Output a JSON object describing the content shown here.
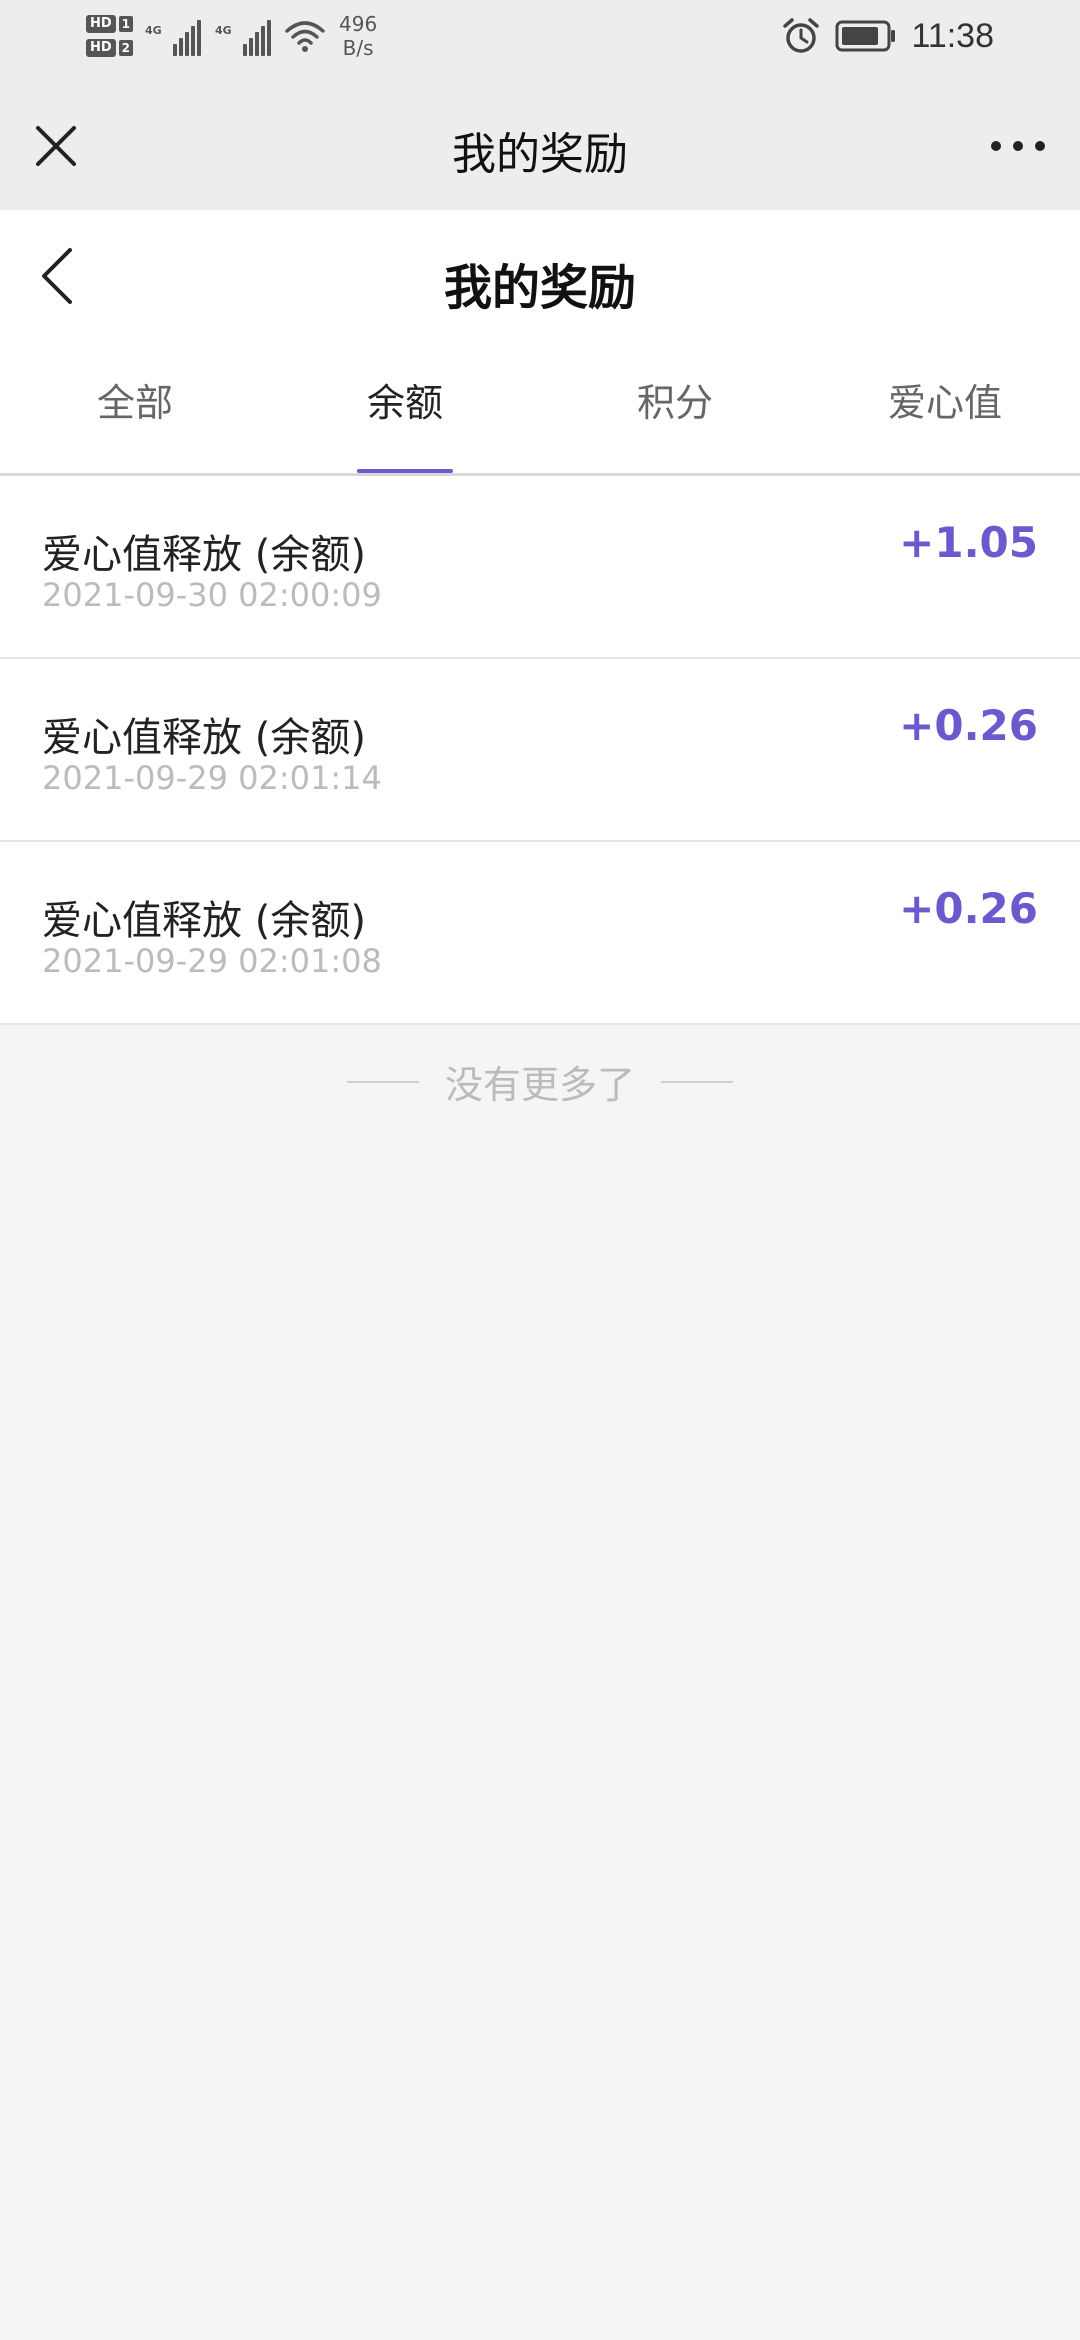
{
  "status_bar": {
    "hd1": "HD",
    "hd1_sim": "1",
    "hd2": "HD",
    "hd2_sim": "2",
    "network1": "4G",
    "network2": "4G",
    "speed_value": "496",
    "speed_unit": "B/s",
    "time": "11:38"
  },
  "nav_bar": {
    "title": "我的奖励"
  },
  "page": {
    "title": "我的奖励"
  },
  "tabs": [
    {
      "label": "全部",
      "active": false
    },
    {
      "label": "余额",
      "active": true
    },
    {
      "label": "积分",
      "active": false
    },
    {
      "label": "爱心值",
      "active": false
    }
  ],
  "records": [
    {
      "title": "爱心值释放 (余额)",
      "time": "2021-09-30 02:00:09",
      "amount": "+1.05"
    },
    {
      "title": "爱心值释放 (余额)",
      "time": "2021-09-29 02:01:14",
      "amount": "+0.26"
    },
    {
      "title": "爱心值释放 (余额)",
      "time": "2021-09-29 02:01:08",
      "amount": "+0.26"
    }
  ],
  "footer": {
    "no_more": "没有更多了"
  },
  "colors": {
    "accent": "#6a5acd",
    "bar_bg": "#ededed",
    "page_bg": "#f5f5f5"
  }
}
